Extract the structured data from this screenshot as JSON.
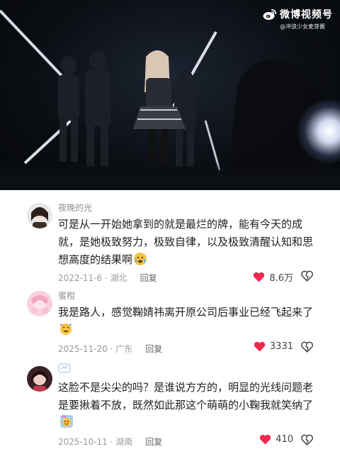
{
  "watermark": {
    "title": "微博视频号",
    "subtitle": "@冲浪少女麦芽酱"
  },
  "comments": [
    {
      "username": "夜晚的光",
      "text": "可是从一开始她拿到的就是最烂的牌，能有今天的成就，是她极致努力，极致自律，以及极致清醒认知和思想高度的结果啊",
      "emoji": "crying-face-emoji",
      "date": "2022-11-6 · 湖北",
      "reply_label": "回复",
      "likes": "8.6万"
    },
    {
      "username": "蜜柑",
      "text": "我是路人，感觉鞠婧祎离开原公司后事业已经飞起来了",
      "emoji": "party-face-emoji",
      "date": "2025-11-20 · 广东",
      "reply_label": "回复",
      "likes": "3331"
    },
    {
      "username": "",
      "text": "这脸不是尖尖的吗？是谁说方方的，明显的光线问题老是要揪着不放，既然如此那这个萌萌的小鞠我就笑纳了",
      "emoji": "sticker-emoji",
      "date": "2025-10-11 · 湖南",
      "reply_label": "回复",
      "likes": "410"
    }
  ],
  "colors": {
    "heart": "#ee2a4f",
    "meta_gray": "#9a9a9a",
    "username_gray": "#8d8d8d"
  }
}
